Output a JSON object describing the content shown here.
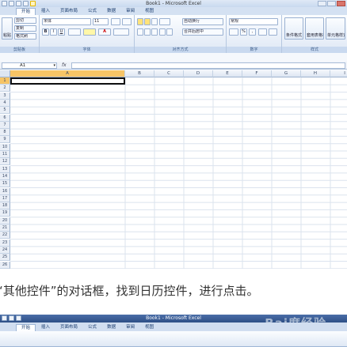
{
  "top_window": {
    "title": "Book1 - Microsoft Excel",
    "tabs": [
      "开始",
      "插入",
      "页面布局",
      "公式",
      "数据",
      "审阅",
      "视图"
    ],
    "groups": {
      "clipboard": {
        "label": "剪贴板",
        "paste": "粘贴",
        "cut": "剪切",
        "copy": "复制",
        "format_painter": "格式刷"
      },
      "font": {
        "label": "字体",
        "font_name": "宋体",
        "font_size": "11"
      },
      "alignment": {
        "label": "对齐方式",
        "wrap": "自动换行",
        "merge": "合并后居中"
      },
      "number": {
        "label": "数字",
        "format": "常规"
      },
      "styles": {
        "label": "样式",
        "conditional": "条件格式",
        "table": "套用表格格式",
        "cell_styles": "单元格样式"
      }
    },
    "name_box": "A1",
    "fx": "fx",
    "columns": [
      "A",
      "B",
      "C",
      "D",
      "E",
      "F",
      "G",
      "H",
      "I"
    ],
    "rows": [
      "1",
      "2",
      "3",
      "4",
      "5",
      "6",
      "7",
      "8",
      "9",
      "10",
      "11",
      "12",
      "13",
      "14",
      "15",
      "16",
      "17",
      "18",
      "19",
      "20",
      "21",
      "22",
      "23",
      "24",
      "25",
      "26"
    ]
  },
  "caption": "“其他控件”的对话框，找到日历控件，进行点击。",
  "bottom_window": {
    "title": "Book1 - Microsoft Excel",
    "tabs": [
      "开始",
      "插入",
      "页面布局",
      "公式",
      "数据",
      "审阅",
      "视图"
    ],
    "watermark": "Bai度经验"
  },
  "colors": {
    "selection": "#f6c466",
    "ribbon": "#dfe8f5",
    "accent": "#2e4f86"
  }
}
